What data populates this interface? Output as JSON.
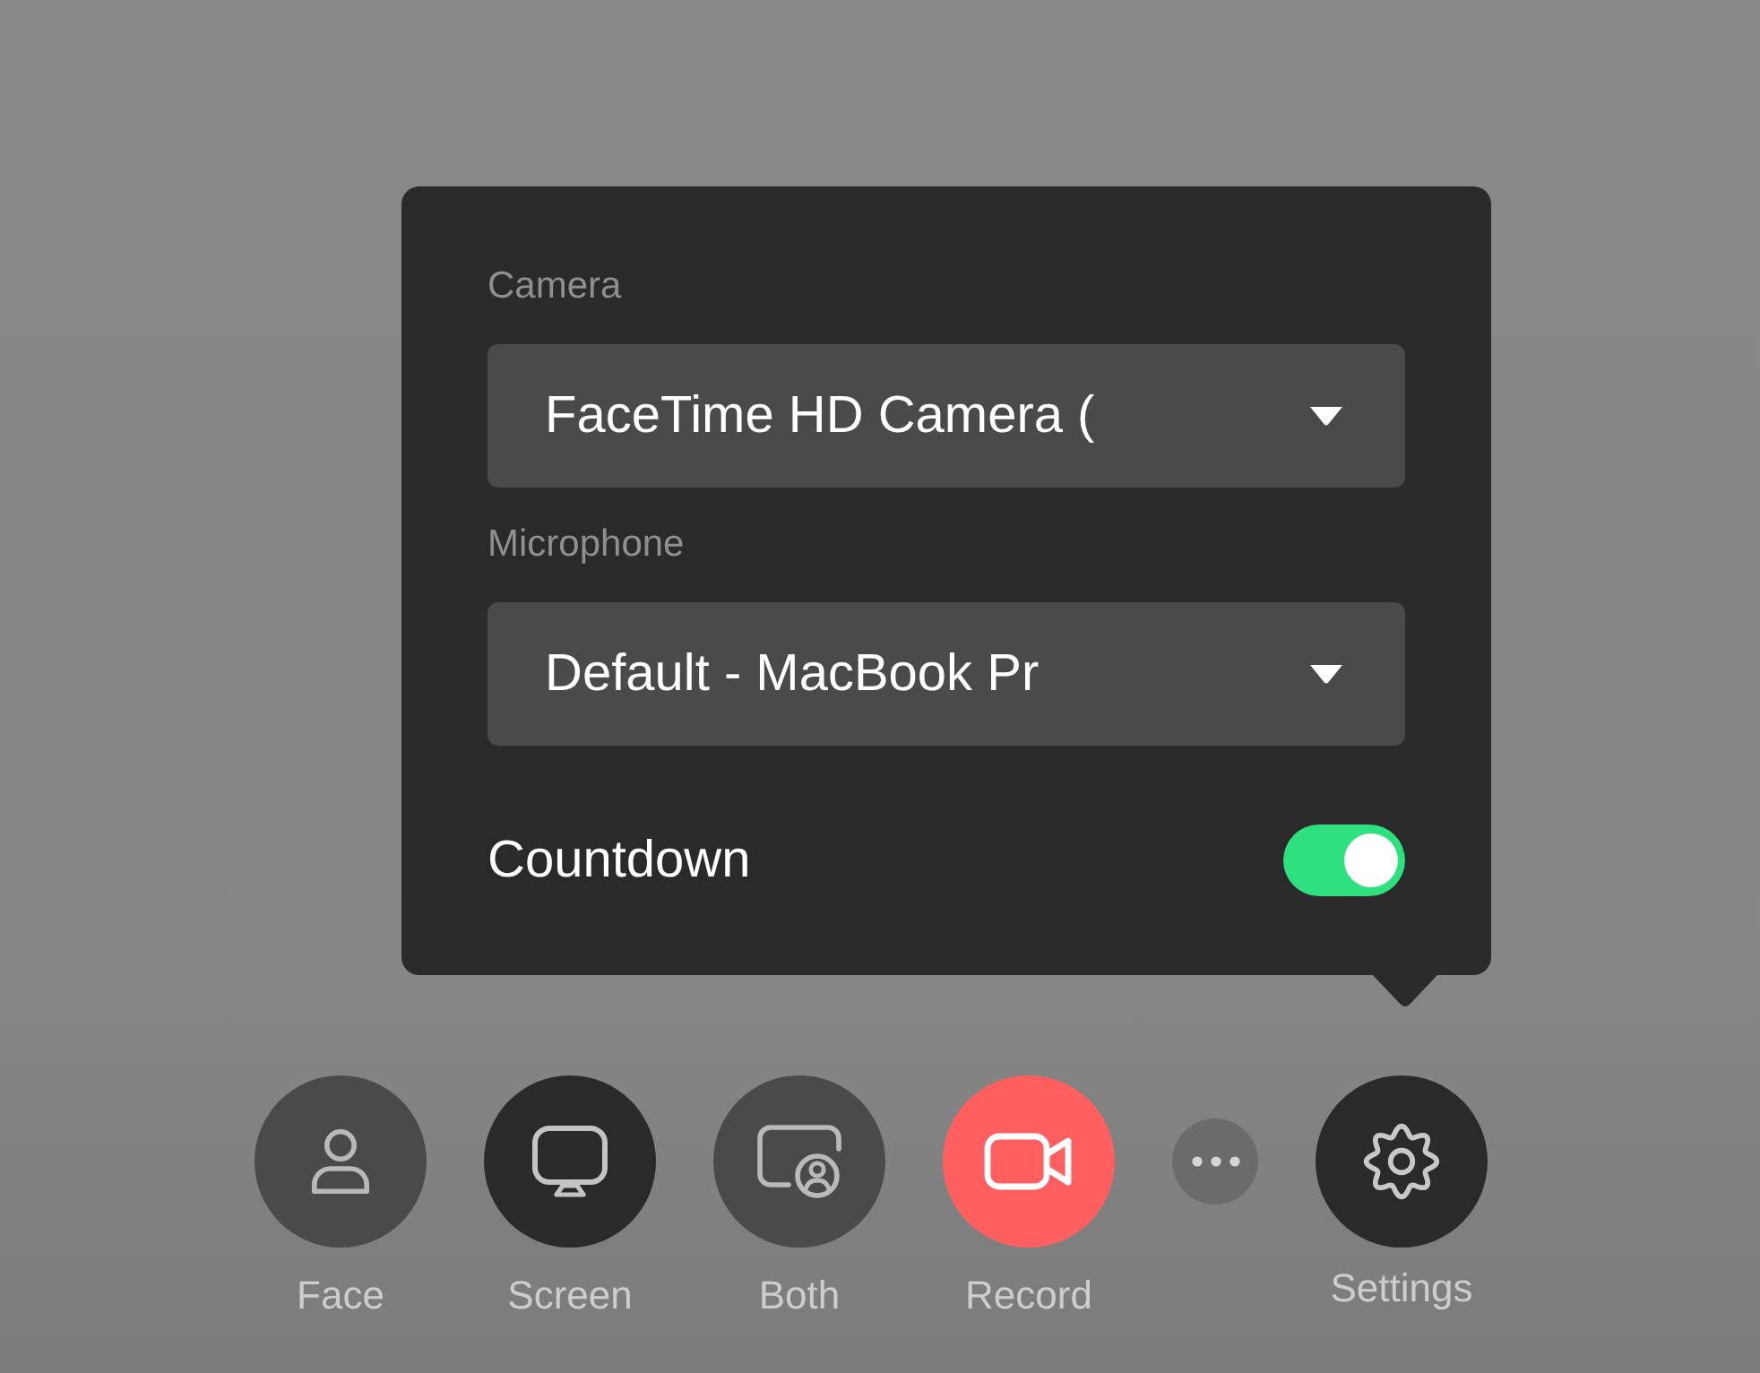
{
  "popover": {
    "fields": [
      {
        "label": "Camera",
        "value": "FaceTime HD Camera ("
      },
      {
        "label": "Microphone",
        "value": "Default - MacBook Pr"
      }
    ],
    "countdown": {
      "label": "Countdown",
      "on": true
    }
  },
  "toolbar": {
    "modes": [
      {
        "kind": "face",
        "label": "Face",
        "selected": false
      },
      {
        "kind": "screen",
        "label": "Screen",
        "selected": true
      },
      {
        "kind": "both",
        "label": "Both",
        "selected": false
      }
    ],
    "record_button": {
      "label": "Record"
    },
    "settings_button": {
      "label": "Settings",
      "open": true
    }
  }
}
